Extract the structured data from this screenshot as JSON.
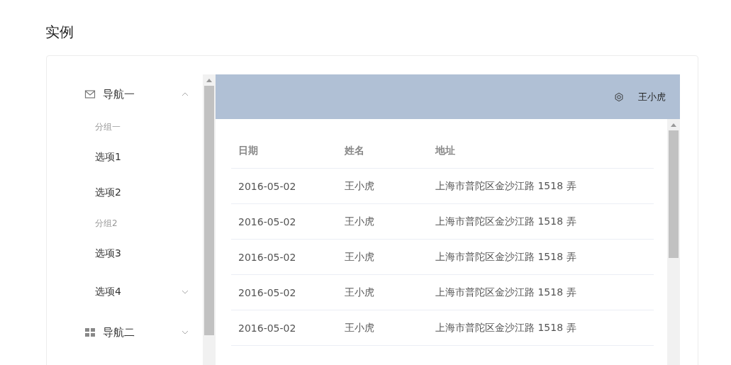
{
  "page_title": "实例",
  "menu": [
    {
      "label": "导航一",
      "expanded": true,
      "groups": [
        {
          "title": "分组一",
          "items": [
            {
              "label": "选项1",
              "kind": "item"
            },
            {
              "label": "选项2",
              "kind": "item"
            }
          ]
        },
        {
          "title": "分组2",
          "items": [
            {
              "label": "选项3",
              "kind": "item"
            },
            {
              "label": "选项4",
              "kind": "submenu",
              "expanded": false
            }
          ]
        }
      ]
    },
    {
      "label": "导航二",
      "expanded": false
    }
  ],
  "header": {
    "user": "王小虎"
  },
  "table": {
    "columns": [
      "日期",
      "姓名",
      "地址"
    ],
    "rows": [
      [
        "2016-05-02",
        "王小虎",
        "上海市普陀区金沙江路 1518 弄"
      ],
      [
        "2016-05-02",
        "王小虎",
        "上海市普陀区金沙江路 1518 弄"
      ],
      [
        "2016-05-02",
        "王小虎",
        "上海市普陀区金沙江路 1518 弄"
      ],
      [
        "2016-05-02",
        "王小虎",
        "上海市普陀区金沙江路 1518 弄"
      ],
      [
        "2016-05-02",
        "王小虎",
        "上海市普陀区金沙江路 1518 弄"
      ]
    ]
  }
}
